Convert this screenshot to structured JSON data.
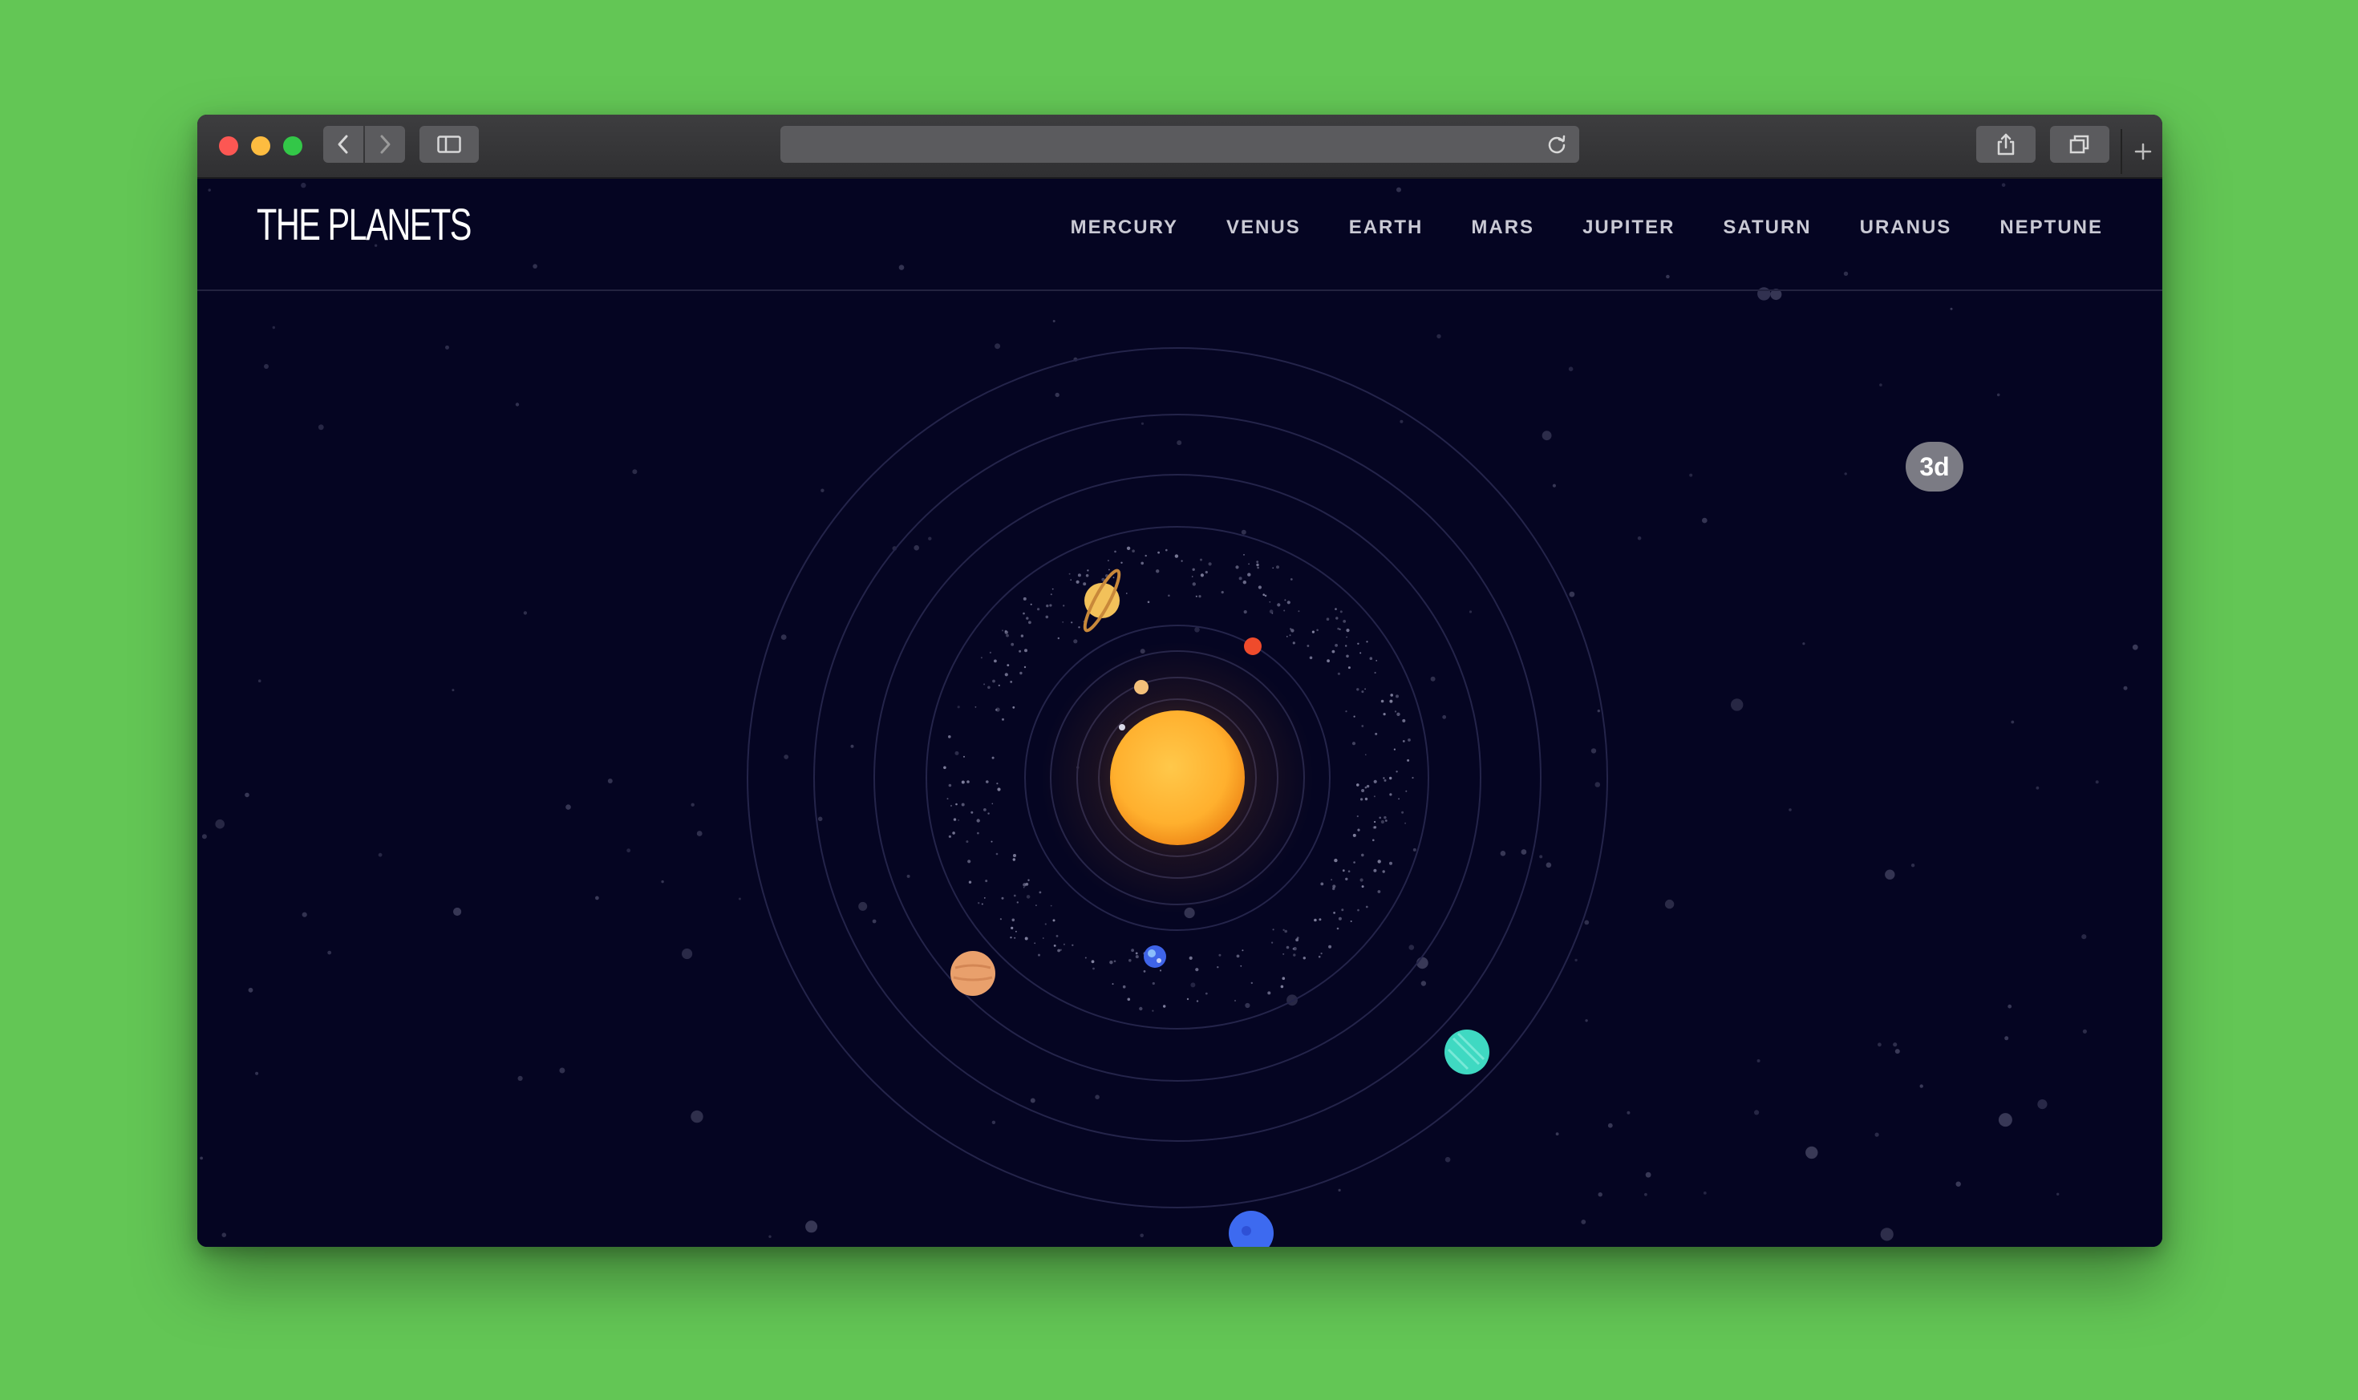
{
  "browser": {
    "address": "",
    "icons": {
      "back": "chevron-left-icon",
      "forward": "chevron-right-icon",
      "sidebar": "sidebar-icon",
      "reload": "reload-icon",
      "share": "share-icon",
      "tabs": "tabs-icon",
      "new_tab": "plus-icon"
    }
  },
  "site": {
    "logo": "THE PLANETS",
    "nav": [
      "MERCURY",
      "VENUS",
      "EARTH",
      "MARS",
      "JUPITER",
      "SATURN",
      "URANUS",
      "NEPTUNE"
    ],
    "view_toggle": "3d"
  },
  "colors": {
    "background": "#050522",
    "sun": "#ffb43a",
    "mercury": "#d9d9e8",
    "venus": "#f3c07a",
    "earth": "#3f64e8",
    "mars": "#ef4b2c",
    "jupiter": "#e9a06c",
    "saturn": "#f2c15a",
    "uranus": "#3fd9c2",
    "neptune": "#3d6af0"
  }
}
